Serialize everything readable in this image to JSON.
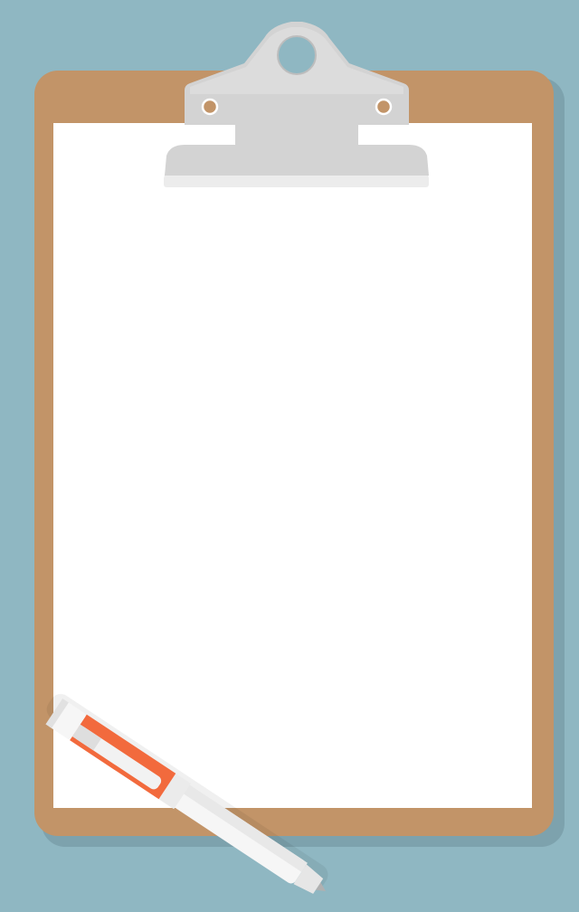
{
  "colors": {
    "background": "#8fb7c2",
    "board": "#c29468",
    "board_shadow": "#7d9ea8",
    "paper": "#ffffff",
    "clip_metal": "#d3d3d3",
    "clip_highlight": "#e8e8e8",
    "pen_body": "#f2f2f2",
    "pen_grip": "#f26a3d",
    "pen_tip": "#c9c9c9"
  },
  "icons": {
    "clip": "clipboard-clip-icon",
    "pen": "pen-icon"
  }
}
